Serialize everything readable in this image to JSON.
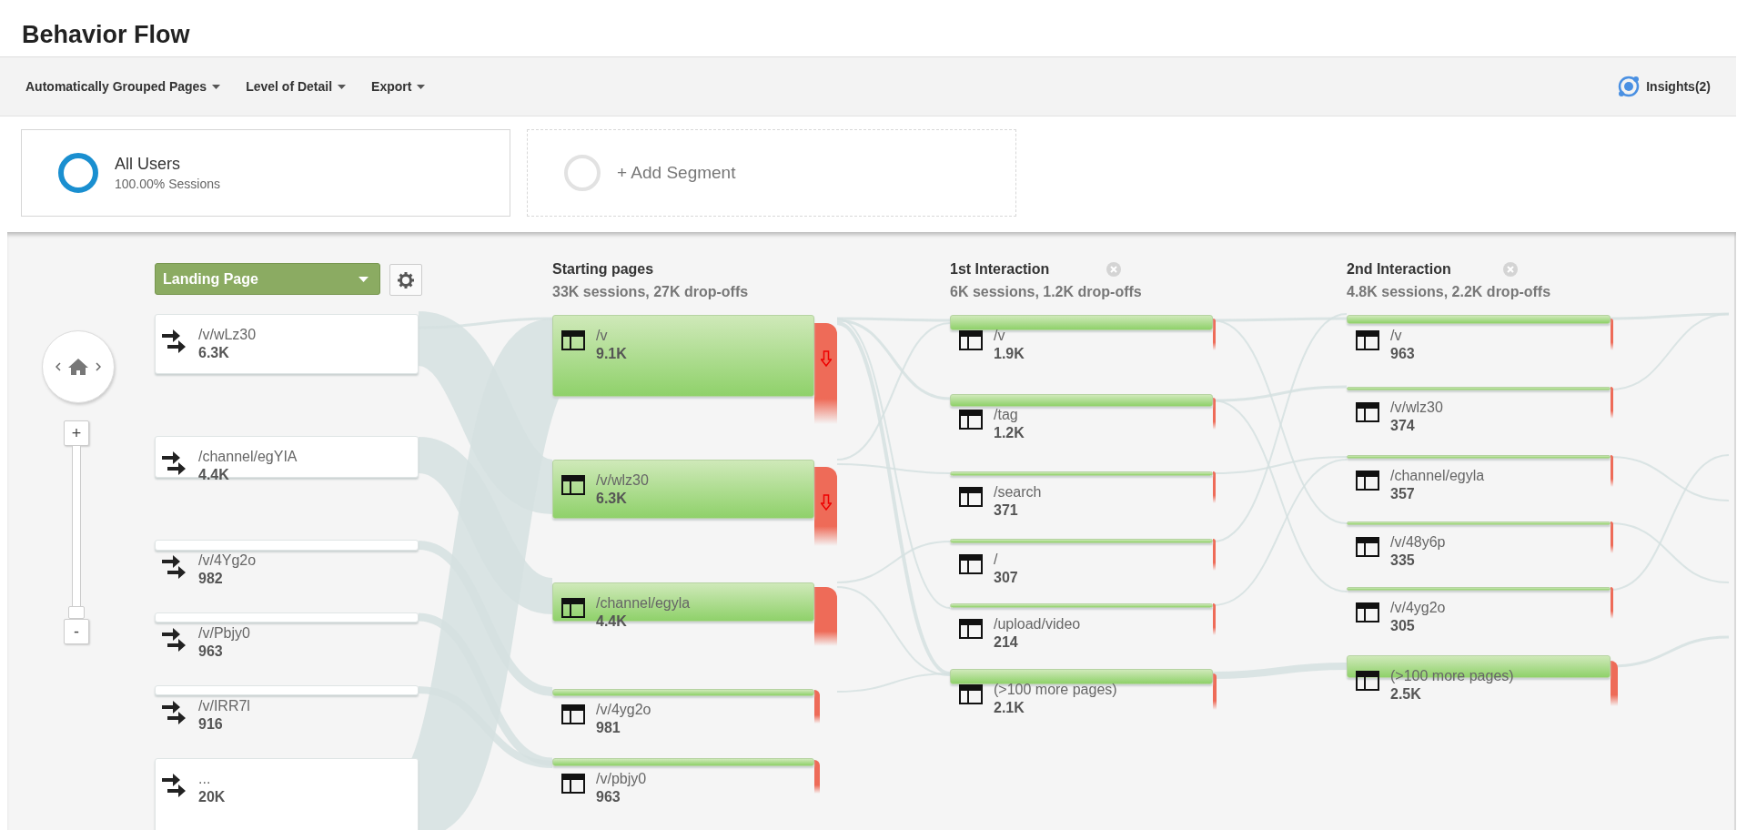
{
  "title": "Behavior Flow",
  "toolbar": {
    "menus": [
      {
        "label": "Automatically Grouped Pages"
      },
      {
        "label": "Level of Detail"
      },
      {
        "label": "Export"
      }
    ],
    "insights": "Insights(2)"
  },
  "segments": [
    {
      "kind": "active",
      "name": "All Users",
      "detail": "100.00% Sessions"
    },
    {
      "kind": "add",
      "name": "+ Add Segment"
    }
  ],
  "zoom": {
    "plus": "+",
    "minus": "-",
    "level": 0
  },
  "columns": [
    {
      "kind": "landing",
      "selector": "Landing Page",
      "nodes": [
        {
          "label": "/v/wLz30",
          "value": "6.3K"
        },
        {
          "label": "/channel/egYIA",
          "value": "4.4K"
        },
        {
          "label": "/v/4Yg2o",
          "value": "982"
        },
        {
          "label": "/v/Pbjy0",
          "value": "963"
        },
        {
          "label": "/v/IRR7l",
          "value": "916"
        },
        {
          "label": "...",
          "value": "20K"
        }
      ]
    },
    {
      "kind": "step",
      "title": "Starting pages",
      "subtitle": "33K sessions, 27K drop-offs",
      "closable": false,
      "nodes": [
        {
          "label": "/v",
          "value": "9.1K",
          "dropoff_arrow": true
        },
        {
          "label": "/v/wlz30",
          "value": "6.3K",
          "dropoff_arrow": true
        },
        {
          "label": "/channel/egyla",
          "value": "4.4K",
          "dropoff_arrow": false
        },
        {
          "label": "/v/4yg2o",
          "value": "981",
          "dropoff_arrow": false
        },
        {
          "label": "/v/pbjy0",
          "value": "963",
          "dropoff_arrow": false
        }
      ]
    },
    {
      "kind": "step",
      "title": "1st Interaction",
      "subtitle": "6K sessions, 1.2K drop-offs",
      "closable": true,
      "nodes": [
        {
          "label": "/v",
          "value": "1.9K",
          "dropoff_arrow": false
        },
        {
          "label": "/tag",
          "value": "1.2K",
          "dropoff_arrow": false
        },
        {
          "label": "/search",
          "value": "371",
          "dropoff_arrow": false
        },
        {
          "label": "/",
          "value": "307",
          "dropoff_arrow": false
        },
        {
          "label": "/upload/video",
          "value": "214",
          "dropoff_arrow": false
        },
        {
          "label": "(>100 more pages)",
          "value": "2.1K",
          "dropoff_arrow": false
        }
      ]
    },
    {
      "kind": "step",
      "title": "2nd Interaction",
      "subtitle": "4.8K sessions, 2.2K drop-offs",
      "closable": true,
      "nodes": [
        {
          "label": "/v",
          "value": "963",
          "dropoff_arrow": false
        },
        {
          "label": "/v/wlz30",
          "value": "374",
          "dropoff_arrow": false
        },
        {
          "label": "/channel/egyla",
          "value": "357",
          "dropoff_arrow": false
        },
        {
          "label": "/v/48y6p",
          "value": "335",
          "dropoff_arrow": false
        },
        {
          "label": "/v/4yg2o",
          "value": "305",
          "dropoff_arrow": false
        },
        {
          "label": "(>100 more pages)",
          "value": "2.5K",
          "dropoff_arrow": false
        }
      ]
    }
  ]
}
